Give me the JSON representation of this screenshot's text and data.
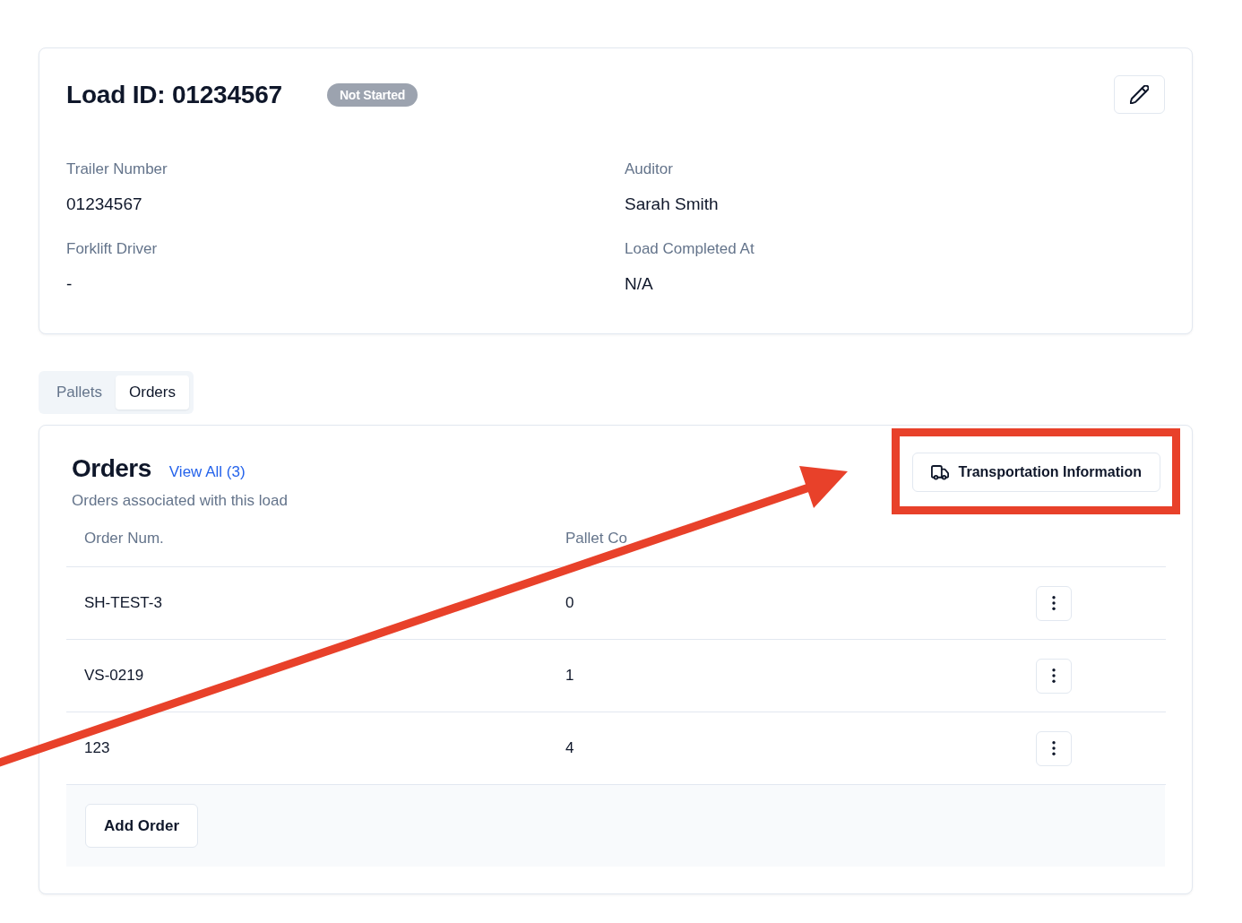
{
  "load": {
    "title": "Load ID: 01234567",
    "status": {
      "label": "Not Started",
      "kind": "neutral"
    },
    "fields": [
      {
        "label": "Trailer Number",
        "value": "01234567"
      },
      {
        "label": "Auditor",
        "value": "Sarah Smith"
      },
      {
        "label": "Forklift Driver",
        "value": "-"
      },
      {
        "label": "Load Completed At",
        "value": "N/A"
      }
    ]
  },
  "tabs": [
    {
      "label": "Pallets",
      "selected": false
    },
    {
      "label": "Orders",
      "selected": true
    }
  ],
  "orders": {
    "title": "Orders",
    "view_all_link": "View All (3)",
    "subtitle": "Orders associated with this load",
    "transportation_button": "Transportation Information",
    "table": {
      "columns": [
        "Order Num.",
        "Pallet Co"
      ],
      "rows": [
        {
          "cells": [
            "SH-TEST-3",
            "0"
          ]
        },
        {
          "cells": [
            "VS-0219",
            "1"
          ]
        },
        {
          "cells": [
            "123",
            "4"
          ]
        }
      ]
    },
    "add_button": "Add Order"
  }
}
